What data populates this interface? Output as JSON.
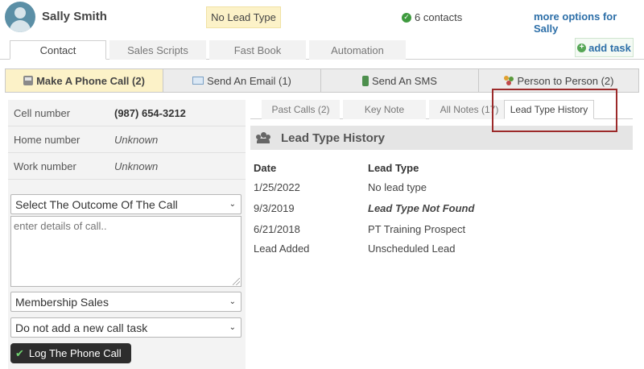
{
  "header": {
    "contact_name": "Sally Smith",
    "lead_type_badge": "No Lead Type",
    "contacts_count": "6 contacts",
    "more_options": "more options for Sally"
  },
  "top_tabs": [
    {
      "label": "Contact",
      "active": true
    },
    {
      "label": "Sales Scripts",
      "active": false
    },
    {
      "label": "Fast Book",
      "active": false
    },
    {
      "label": "Automation",
      "active": false
    }
  ],
  "add_task_label": "add task",
  "action_tabs": [
    {
      "label": "Make A Phone Call (2)",
      "icon": "phone-icon",
      "active": true
    },
    {
      "label": "Send An Email (1)",
      "icon": "email-icon",
      "active": false
    },
    {
      "label": "Send An SMS",
      "icon": "sms-icon",
      "active": false
    },
    {
      "label": "Person to Person (2)",
      "icon": "people-icon",
      "active": false
    }
  ],
  "phone_numbers": [
    {
      "label": "Cell number",
      "value": "(987) 654-3212"
    },
    {
      "label": "Home number",
      "value": "Unknown"
    },
    {
      "label": "Work number",
      "value": "Unknown"
    }
  ],
  "call_form": {
    "outcome_select": "Select The Outcome Of The Call",
    "details_placeholder": "enter details of call..",
    "category_select": "Membership Sales",
    "task_select": "Do not add a new call task",
    "log_button": "Log The Phone Call"
  },
  "sub_tabs": [
    {
      "label": "Past Calls (2)",
      "active": false
    },
    {
      "label": "Key Note",
      "active": false
    },
    {
      "label": "All Notes (17)",
      "active": false
    },
    {
      "label": "Lead Type History",
      "active": true
    }
  ],
  "lead_history": {
    "title": "Lead Type History",
    "col_date": "Date",
    "col_lead_type": "Lead Type",
    "rows": [
      {
        "date": "1/25/2022",
        "lead_type": "No lead type"
      },
      {
        "date": "9/3/2019",
        "lead_type": "Lead Type Not Found"
      },
      {
        "date": "6/21/2018",
        "lead_type": "PT Training Prospect"
      },
      {
        "date": "Lead Added",
        "lead_type": "Unscheduled Lead"
      }
    ]
  },
  "colors": {
    "accent_link": "#2d6fa8",
    "active_tab_bg": "#fcf2c8",
    "highlight_border": "#9c2a2a"
  }
}
